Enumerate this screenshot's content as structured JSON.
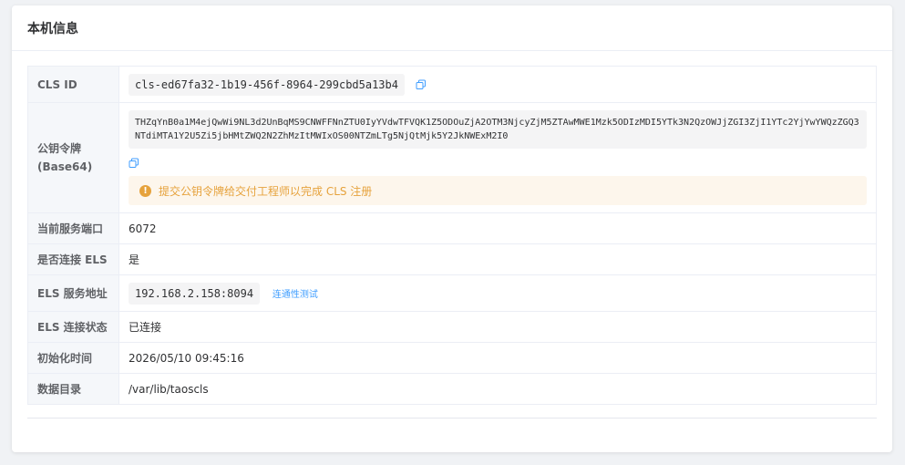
{
  "card": {
    "title": "本机信息"
  },
  "rows": {
    "cls_id": {
      "label": "CLS ID",
      "value": "cls-ed67fa32-1b19-456f-8964-299cbd5a13b4"
    },
    "public_key": {
      "label": "公钥令牌(Base64)",
      "value": "THZqYnB0a1M4ejQwWi9NL3d2UnBqMS9CNWFFNnZTU0IyYVdwTFVQK1Z5ODOuZjA2OTM3NjcyZjM5ZTAwMWE1Mzk5ODIzMDI5YTk3N2QzOWJjZGI3ZjI1YTc2YjYwYWQzZGQ3NTdiMTA1Y2U5Zi5jbHMtZWQ2N2ZhMzItMWIxOS00NTZmLTg5NjQtMjk5Y2JkNWExM2I0",
      "alert": "提交公钥令牌给交付工程师以完成 CLS 注册"
    },
    "port": {
      "label": "当前服务端口",
      "value": "6072"
    },
    "els_connected": {
      "label": "是否连接 ELS",
      "value": "是"
    },
    "els_address": {
      "label": "ELS 服务地址",
      "value": "192.168.2.158:8094",
      "test_link": "连通性测试"
    },
    "els_status": {
      "label": "ELS 连接状态",
      "value": "已连接"
    },
    "init_time": {
      "label": "初始化时间",
      "value": "2026/05/10 09:45:16"
    },
    "data_dir": {
      "label": "数据目录",
      "value": "/var/lib/taoscls"
    }
  },
  "icons": {
    "copy": "copy-icon",
    "warning": "warning-icon"
  },
  "colors": {
    "link": "#409eff",
    "warning": "#e6a23c",
    "label_bg": "#f5f7fa"
  }
}
